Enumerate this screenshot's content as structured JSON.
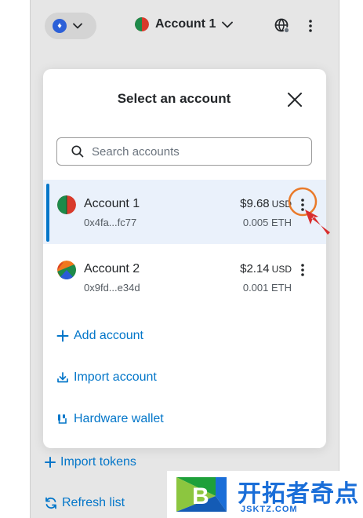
{
  "header": {
    "account_label": "Account 1",
    "network_icon": "ethereum-icon"
  },
  "modal": {
    "title": "Select an account",
    "search_placeholder": "Search accounts",
    "search_value": "",
    "accounts": [
      {
        "name": "Account 1",
        "address": "0x4fa...fc77",
        "fiat_value": "$9.68",
        "fiat_currency": "USD",
        "crypto_value": "0.005 ETH",
        "selected": true
      },
      {
        "name": "Account 2",
        "address": "0x9fd...e34d",
        "fiat_value": "$2.14",
        "fiat_currency": "USD",
        "crypto_value": "0.001 ETH",
        "selected": false
      }
    ],
    "actions": {
      "add_account": "Add account",
      "import_account": "Import account",
      "hardware_wallet": "Hardware wallet"
    }
  },
  "background_links": {
    "import_tokens": "Import tokens",
    "refresh_list": "Refresh list"
  },
  "watermark": {
    "title": "开拓者奇点",
    "subtitle": "JSKTZ.COM",
    "logo_letter": "B"
  },
  "colors": {
    "accent": "#0376c9",
    "selected_row_bg": "#eaf1fb",
    "annotation": "#e97a2a",
    "annotation_arrow": "#d92e2e"
  }
}
